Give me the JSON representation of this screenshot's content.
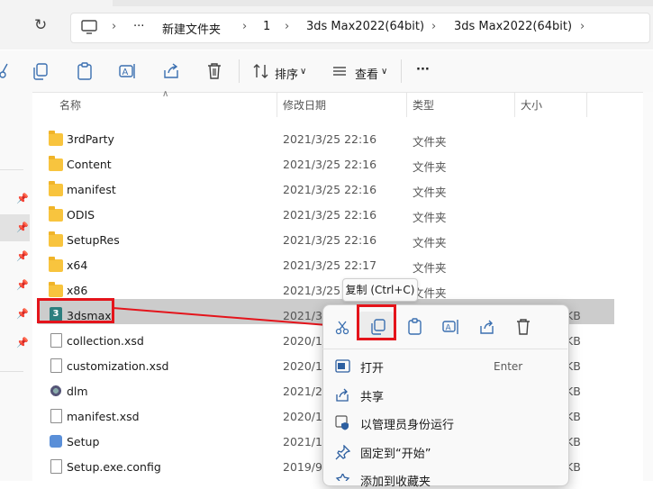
{
  "address_bar": {
    "overflow": "···",
    "breadcrumbs": [
      "新建文件夹",
      "1",
      "3ds Max2022(64bit)",
      "3ds Max2022(64bit)"
    ]
  },
  "toolbar": {
    "sort_label": "排序",
    "view_label": "查看",
    "more_label": "···"
  },
  "columns": {
    "name": "名称",
    "date": "修改日期",
    "type": "类型",
    "size": "大小"
  },
  "files": [
    {
      "name": "3rdParty",
      "date": "2021/3/25 22:16",
      "type": "文件夹",
      "size": "",
      "icon": "folder-icon"
    },
    {
      "name": "Content",
      "date": "2021/3/25 22:16",
      "type": "文件夹",
      "size": "",
      "icon": "folder-icon"
    },
    {
      "name": "manifest",
      "date": "2021/3/25 22:16",
      "type": "文件夹",
      "size": "",
      "icon": "folder-icon"
    },
    {
      "name": "ODIS",
      "date": "2021/3/25 22:16",
      "type": "文件夹",
      "size": "",
      "icon": "folder-icon"
    },
    {
      "name": "SetupRes",
      "date": "2021/3/25 22:16",
      "type": "文件夹",
      "size": "",
      "icon": "folder-icon"
    },
    {
      "name": "x64",
      "date": "2021/3/25 22:17",
      "type": "文件夹",
      "size": "",
      "icon": "folder-icon"
    },
    {
      "name": "x86",
      "date": "2021/3/25 22",
      "type": "文件夹",
      "size": "",
      "icon": "folder-icon"
    },
    {
      "name": "3dsmax",
      "date": "2021/3/",
      "type": "",
      "size": "KB",
      "icon": "3dsmax-icon"
    },
    {
      "name": "collection.xsd",
      "date": "2020/10",
      "type": "",
      "size": "KB",
      "icon": "document-icon"
    },
    {
      "name": "customization.xsd",
      "date": "2020/12",
      "type": "",
      "size": "KB",
      "icon": "document-icon"
    },
    {
      "name": "dlm",
      "date": "2021/2/",
      "type": "",
      "size": "KB",
      "icon": "gear-document-icon"
    },
    {
      "name": "manifest.xsd",
      "date": "2020/12",
      "type": "",
      "size": "KB",
      "icon": "document-icon"
    },
    {
      "name": "Setup",
      "date": "2021/1/",
      "type": "",
      "size": "KB",
      "icon": "setup-icon"
    },
    {
      "name": "Setup.exe.config",
      "date": "2019/9/",
      "type": "",
      "size": "KB",
      "icon": "document-icon"
    }
  ],
  "tooltip": "复制 (Ctrl+C)",
  "context_menu": {
    "items": [
      {
        "label": "打开",
        "shortcut": "Enter",
        "icon": "open-icon"
      },
      {
        "label": "共享",
        "shortcut": "",
        "icon": "share-icon"
      },
      {
        "label": "以管理员身份运行",
        "shortcut": "",
        "icon": "admin-shield-icon"
      },
      {
        "label": "固定到“开始”",
        "shortcut": "",
        "icon": "pin-icon"
      },
      {
        "label": "添加到收藏夹",
        "shortcut": "",
        "icon": "star-icon"
      }
    ]
  },
  "colors": {
    "annotation_red": "#e4141b",
    "selection": "#cccccc",
    "folder_yellow": "#f8c43e"
  }
}
